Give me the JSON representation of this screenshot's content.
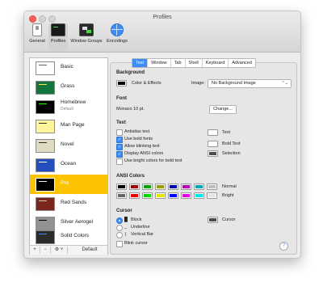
{
  "window": {
    "title": "Profiles"
  },
  "toolbar": [
    {
      "label": "General",
      "icon": "switch-icon"
    },
    {
      "label": "Profiles",
      "icon": "terminal-icon"
    },
    {
      "label": "Window Groups",
      "icon": "window-groups-icon"
    },
    {
      "label": "Encodings",
      "icon": "globe-icon"
    }
  ],
  "profiles": [
    {
      "name": "Basic",
      "sub": "",
      "color": "#ffffff",
      "accent": "#666666"
    },
    {
      "name": "Grass",
      "sub": "",
      "color": "#13773d",
      "accent": "#ffe34d"
    },
    {
      "name": "Homebrew",
      "sub": "Default",
      "color": "#000000",
      "accent": "#28fe14"
    },
    {
      "name": "Man Page",
      "sub": "",
      "color": "#fef49c",
      "accent": "#333333"
    },
    {
      "name": "Novel",
      "sub": "",
      "color": "#dfdbc3",
      "accent": "#3b2322"
    },
    {
      "name": "Ocean",
      "sub": "",
      "color": "#224fbc",
      "accent": "#ffffff"
    },
    {
      "name": "Pro",
      "sub": "",
      "color": "#000000",
      "accent": "#f2f2f2"
    },
    {
      "name": "Red Sands",
      "sub": "",
      "color": "#7a251e",
      "accent": "#d7c9a7"
    },
    {
      "name": "Silver Aerogel",
      "sub": "",
      "color": "#929292",
      "accent": "#000000"
    },
    {
      "name": "Solid Colors",
      "sub": "",
      "color": "#2b2b2b",
      "accent": "#3d8cf7"
    }
  ],
  "sidebar_footer": {
    "add": "+",
    "remove": "−",
    "action": "⚙ ˅",
    "default": "Default"
  },
  "tabs": [
    "Text",
    "Window",
    "Tab",
    "Shell",
    "Keyboard",
    "Advanced"
  ],
  "background": {
    "heading": "Background",
    "color_effects": "Color & Effects",
    "image_label": "Image:",
    "image_value": "No Background Image",
    "popup_arrow": "⌃⌄"
  },
  "font": {
    "heading": "Font",
    "value": "Monaco 10 pt.",
    "change_button": "Change..."
  },
  "text": {
    "heading": "Text",
    "options": [
      {
        "label": "Antialias text",
        "checked": false
      },
      {
        "label": "Use bold fonts",
        "checked": true
      },
      {
        "label": "Allow blinking text",
        "checked": true
      },
      {
        "label": "Display ANSI colors",
        "checked": true
      },
      {
        "label": "Use bright colors for bold text",
        "checked": false
      }
    ],
    "colors": [
      {
        "label": "Text",
        "color": "#ffffff"
      },
      {
        "label": "Bold Text",
        "color": "#ffffff"
      },
      {
        "label": "Selection",
        "color": "#4d4d4d"
      }
    ],
    "check_mark": "✓"
  },
  "ansi": {
    "heading": "ANSI Colors",
    "normal_label": "Normal",
    "bright_label": "Bright",
    "normal": [
      "#000000",
      "#990000",
      "#00a600",
      "#999900",
      "#0000b2",
      "#b200b2",
      "#00a6b2",
      "#bfbfbf"
    ],
    "bright": [
      "#666666",
      "#e50000",
      "#00d900",
      "#e5e500",
      "#0000ff",
      "#e500e5",
      "#00e5e5",
      "#e5e5e5"
    ]
  },
  "cursor": {
    "heading": "Cursor",
    "options": [
      {
        "glyph": "█",
        "label": "Block",
        "selected": true
      },
      {
        "glyph": "_",
        "label": "Underline",
        "selected": false
      },
      {
        "glyph": "|",
        "label": "Vertical Bar",
        "selected": false
      }
    ],
    "blink": "Blink cursor",
    "cursor_label": "Cursor",
    "cursor_color": "#4d4d4d"
  },
  "help": "?"
}
